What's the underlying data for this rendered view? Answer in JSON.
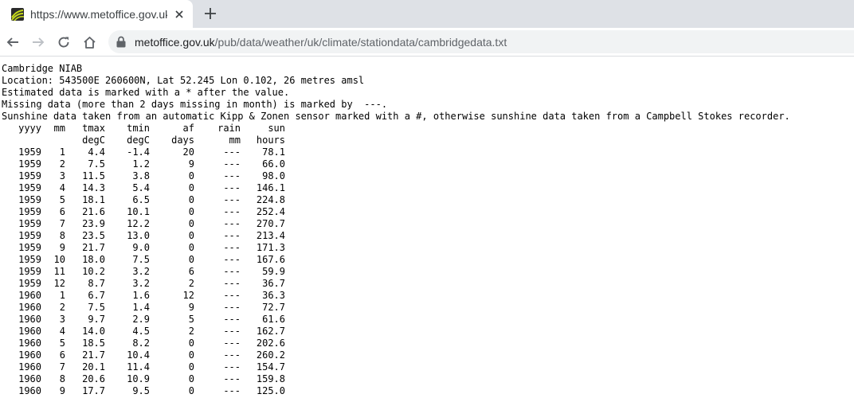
{
  "browser": {
    "tab_title": "https://www.metoffice.gov.uk/pub/data/weather/uk/climate/stationdata/cambridgedata.txt",
    "url_host": "metoffice.gov.uk",
    "url_path": "/pub/data/weather/uk/climate/stationdata/cambridgedata.txt",
    "icons": {
      "favicon": "metoffice-favicon",
      "close": "close-icon",
      "new_tab": "plus-icon",
      "back": "arrow-left-icon",
      "forward": "arrow-right-icon",
      "reload": "reload-icon",
      "home": "home-icon",
      "secure": "lock-icon"
    }
  },
  "document": {
    "header_lines": [
      "Cambridge NIAB",
      "Location: 543500E 260600N, Lat 52.245 Lon 0.102, 26 metres amsl",
      "Estimated data is marked with a * after the value.",
      "Missing data (more than 2 days missing in month) is marked by  ---.",
      "Sunshine data taken from an automatic Kipp & Zonen sensor marked with a #, otherwise sunshine data taken from a Campbell Stokes recorder."
    ],
    "columns": [
      "yyyy",
      "mm",
      "tmax",
      "tmin",
      "af",
      "rain",
      "sun"
    ],
    "units": [
      "",
      "",
      "degC",
      "degC",
      "days",
      "mm",
      "hours"
    ],
    "rows": [
      [
        "1959",
        "1",
        "4.4",
        "-1.4",
        "20",
        "---",
        "78.1"
      ],
      [
        "1959",
        "2",
        "7.5",
        "1.2",
        "9",
        "---",
        "66.0"
      ],
      [
        "1959",
        "3",
        "11.5",
        "3.8",
        "0",
        "---",
        "98.0"
      ],
      [
        "1959",
        "4",
        "14.3",
        "5.4",
        "0",
        "---",
        "146.1"
      ],
      [
        "1959",
        "5",
        "18.1",
        "6.5",
        "0",
        "---",
        "224.8"
      ],
      [
        "1959",
        "6",
        "21.6",
        "10.1",
        "0",
        "---",
        "252.4"
      ],
      [
        "1959",
        "7",
        "23.9",
        "12.2",
        "0",
        "---",
        "270.7"
      ],
      [
        "1959",
        "8",
        "23.5",
        "13.0",
        "0",
        "---",
        "213.4"
      ],
      [
        "1959",
        "9",
        "21.7",
        "9.0",
        "0",
        "---",
        "171.3"
      ],
      [
        "1959",
        "10",
        "18.0",
        "7.5",
        "0",
        "---",
        "167.6"
      ],
      [
        "1959",
        "11",
        "10.2",
        "3.2",
        "6",
        "---",
        "59.9"
      ],
      [
        "1959",
        "12",
        "8.7",
        "3.2",
        "2",
        "---",
        "36.7"
      ],
      [
        "1960",
        "1",
        "6.7",
        "1.6",
        "12",
        "---",
        "36.3"
      ],
      [
        "1960",
        "2",
        "7.5",
        "1.4",
        "9",
        "---",
        "72.7"
      ],
      [
        "1960",
        "3",
        "9.7",
        "2.9",
        "5",
        "---",
        "61.6"
      ],
      [
        "1960",
        "4",
        "14.0",
        "4.5",
        "2",
        "---",
        "162.7"
      ],
      [
        "1960",
        "5",
        "18.5",
        "8.2",
        "0",
        "---",
        "202.6"
      ],
      [
        "1960",
        "6",
        "21.7",
        "10.4",
        "0",
        "---",
        "260.2"
      ],
      [
        "1960",
        "7",
        "20.1",
        "11.4",
        "0",
        "---",
        "154.7"
      ],
      [
        "1960",
        "8",
        "20.6",
        "10.9",
        "0",
        "---",
        "159.8"
      ],
      [
        "1960",
        "9",
        "17.7",
        "9.5",
        "0",
        "---",
        "125.0"
      ]
    ]
  }
}
